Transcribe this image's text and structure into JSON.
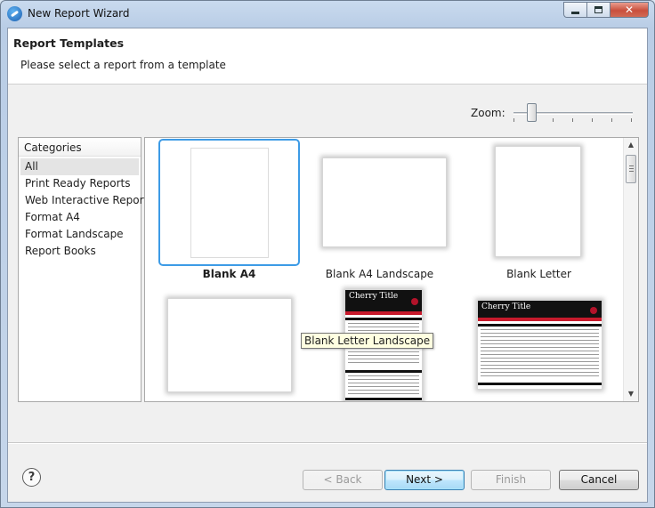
{
  "window": {
    "title": "New Report Wizard",
    "controls": {
      "minimize": "",
      "maximize": "",
      "close": "✕"
    }
  },
  "header": {
    "title": "Report Templates",
    "subtitle": "Please select a report from a template"
  },
  "zoom": {
    "label": "Zoom:",
    "level_fraction": 0.12
  },
  "categories": {
    "header": "Categories",
    "items": [
      {
        "label": "All",
        "selected": true
      },
      {
        "label": "Print Ready Reports"
      },
      {
        "label": "Web Interactive Reports"
      },
      {
        "label": "Format A4"
      },
      {
        "label": "Format Landscape"
      },
      {
        "label": "Report Books"
      }
    ]
  },
  "templates": [
    {
      "label": "Blank A4",
      "selected": true
    },
    {
      "label": "Blank A4 Landscape"
    },
    {
      "label": "Blank Letter"
    },
    {
      "label": "Blank Letter Landscape"
    },
    {
      "label": "Cherry Title"
    },
    {
      "label": "Cherry Title"
    }
  ],
  "tooltip": "Blank Letter Landscape",
  "buttons": {
    "help": "?",
    "back": "< Back",
    "next": "Next >",
    "finish": "Finish",
    "cancel": "Cancel"
  },
  "scrollbar": {
    "up": "▲",
    "down": "▼"
  },
  "colors": {
    "selection_border": "#3d9be6",
    "cherry_red": "#c81a2c",
    "default_button": "#3c7fb1"
  }
}
